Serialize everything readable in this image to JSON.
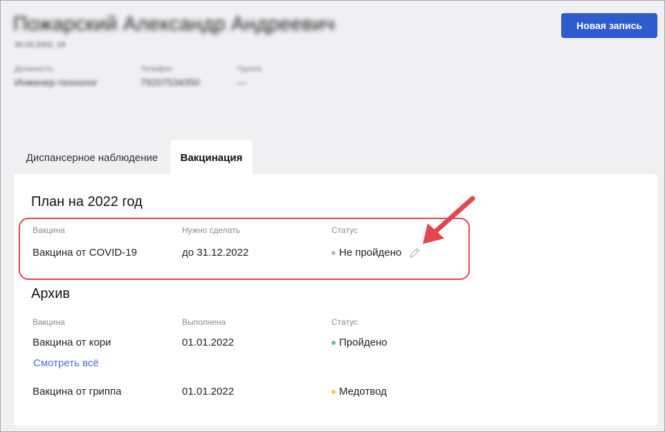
{
  "header": {
    "patient_name": "Пожарский Александр Андреевич",
    "dob": "30.03.2002, 19",
    "fields": [
      {
        "label": "Должность",
        "value": "Инженер-технолог"
      },
      {
        "label": "Телефон",
        "value": "79207534350"
      },
      {
        "label": "Группа",
        "value": "—"
      }
    ],
    "new_record_label": "Новая запись"
  },
  "tabs": [
    {
      "label": "Диспансерное наблюдение",
      "active": false
    },
    {
      "label": "Вакцинация",
      "active": true
    }
  ],
  "plan": {
    "title": "План на 2022 год",
    "columns": [
      "Вакцина",
      "Нужно сделать",
      "Статус"
    ],
    "rows": [
      {
        "vaccine": "Вакцина от COVID-19",
        "due": "до 31.12.2022",
        "status": "Не пройдено",
        "status_color": "#b8b8b8"
      }
    ]
  },
  "archive": {
    "title": "Архив",
    "columns": [
      "Вакцина",
      "Выполнена",
      "Статус"
    ],
    "rows": [
      {
        "vaccine": "Вакцина от кори",
        "done": "01.01.2022",
        "status": "Пройдено",
        "status_color": "#5cc98a"
      },
      {
        "vaccine": "Вакцина от гриппа",
        "done": "01.01.2022",
        "status": "Медотвод",
        "status_color": "#f3c94f"
      }
    ],
    "see_all_label": "Смотреть всё"
  },
  "colors": {
    "primary": "#2e5ccf",
    "annotation": "#e2464f",
    "link": "#4a6fd8"
  },
  "icons": {
    "edit": "pencil-icon",
    "annotation_arrow": "arrow-icon"
  }
}
